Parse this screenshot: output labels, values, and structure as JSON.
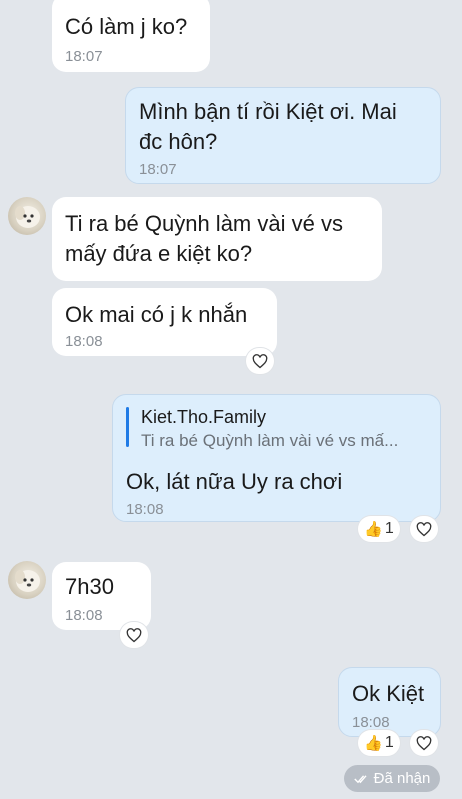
{
  "messages": [
    {
      "text": "Có làm j ko?",
      "time": "18:07"
    },
    {
      "text": "Mình bận tí rồi Kiệt ơi. Mai\nđc hôn?",
      "time": "18:07"
    },
    {
      "text": "Ti ra bé Quỳnh làm vài vé vs\nmấy đứa e kiệt ko?"
    },
    {
      "text": "Ok mai có j k nhắn",
      "time": "18:08"
    },
    {
      "quote_name": "Kiet.Tho.Family",
      "quote_text": "Ti ra bé Quỳnh làm vài vé vs mấ...",
      "text": "Ok, lát nữa Uy ra chơi",
      "time": "18:08",
      "reaction_count": "1"
    },
    {
      "text": "7h30",
      "time": "18:08"
    },
    {
      "text": "Ok Kiệt",
      "time": "18:08",
      "reaction_count": "1"
    }
  ],
  "status": {
    "label": "Đã nhận",
    "icon": "double-check-icon"
  },
  "icons": {
    "like": "heart-outline-icon",
    "reaction": "thumbs-up-emoji"
  },
  "colors": {
    "background": "#e2e6eb",
    "outgoing": "#ddeefc",
    "incoming": "#ffffff",
    "quote_bar": "#1f7be6"
  }
}
